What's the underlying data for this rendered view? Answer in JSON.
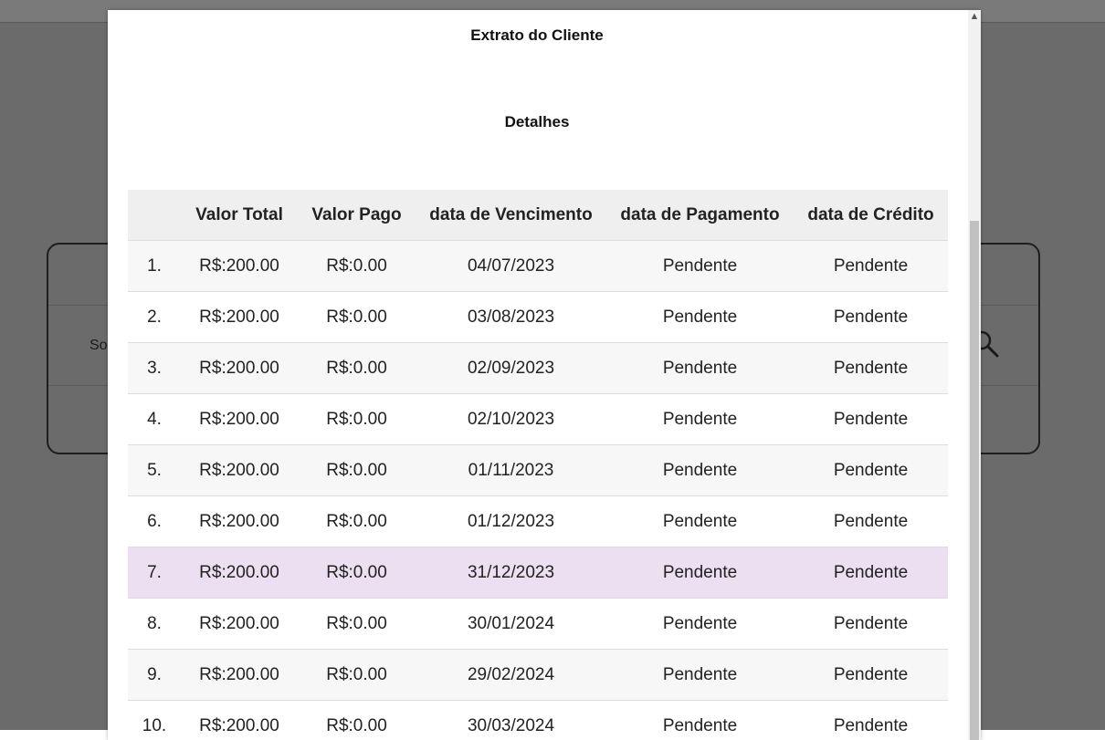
{
  "background": {
    "card_label": "So"
  },
  "modal": {
    "title": "Extrato do Cliente",
    "subtitle": "Detalhes",
    "table": {
      "headers": [
        "",
        "Valor Total",
        "Valor Pago",
        "data de Vencimento",
        "data de Pagamento",
        "data de Crédito"
      ],
      "rows": [
        [
          "1.",
          "R$:200.00",
          "R$:0.00",
          "04/07/2023",
          "Pendente",
          "Pendente"
        ],
        [
          "2.",
          "R$:200.00",
          "R$:0.00",
          "03/08/2023",
          "Pendente",
          "Pendente"
        ],
        [
          "3.",
          "R$:200.00",
          "R$:0.00",
          "02/09/2023",
          "Pendente",
          "Pendente"
        ],
        [
          "4.",
          "R$:200.00",
          "R$:0.00",
          "02/10/2023",
          "Pendente",
          "Pendente"
        ],
        [
          "5.",
          "R$:200.00",
          "R$:0.00",
          "01/11/2023",
          "Pendente",
          "Pendente"
        ],
        [
          "6.",
          "R$:200.00",
          "R$:0.00",
          "01/12/2023",
          "Pendente",
          "Pendente"
        ],
        [
          "7.",
          "R$:200.00",
          "R$:0.00",
          "31/12/2023",
          "Pendente",
          "Pendente"
        ],
        [
          "8.",
          "R$:200.00",
          "R$:0.00",
          "30/01/2024",
          "Pendente",
          "Pendente"
        ],
        [
          "9.",
          "R$:200.00",
          "R$:0.00",
          "29/02/2024",
          "Pendente",
          "Pendente"
        ],
        [
          "10.",
          "R$:200.00",
          "R$:0.00",
          "30/03/2024",
          "Pendente",
          "Pendente"
        ]
      ],
      "highlighted_row": 7,
      "highlight_color": "#ebdff1"
    }
  },
  "icons": {
    "scroll_up": "scroll-up-arrow-icon",
    "search": "search-icon"
  }
}
